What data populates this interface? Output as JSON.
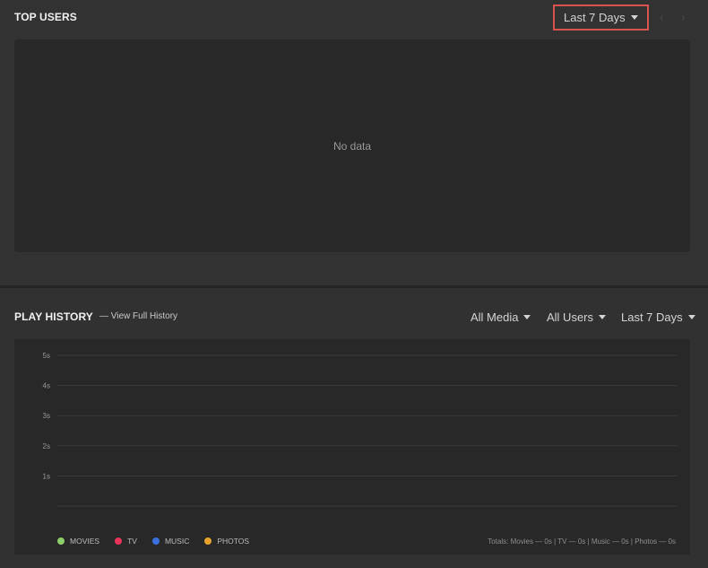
{
  "top_users": {
    "title": "TOP USERS",
    "range_label": "Last 7 Days",
    "prev_icon": "chevron-left-icon",
    "next_icon": "chevron-right-icon",
    "empty_text": "No data"
  },
  "play_history": {
    "title": "PLAY HISTORY",
    "link": "— View Full History",
    "filters": {
      "media": "All Media",
      "users": "All Users",
      "range": "Last 7 Days"
    },
    "totals": "Totals: Movies — 0s | TV — 0s | Music — 0s | Photos — 0s"
  },
  "colors": {
    "highlight": "#d9534f",
    "movies": "#8fcf6b",
    "tv": "#e8335a",
    "music": "#3b6fe0",
    "photos": "#e8a32a"
  },
  "chart_data": {
    "type": "line",
    "title": "",
    "xlabel": "",
    "ylabel": "",
    "ylim": [
      0,
      5
    ],
    "yticks": [
      "5s",
      "4s",
      "3s",
      "2s",
      "1s"
    ],
    "grid": true,
    "legend_position": "bottom-left",
    "legend": [
      "MOVIES",
      "TV",
      "MUSIC",
      "PHOTOS"
    ],
    "series": []
  }
}
